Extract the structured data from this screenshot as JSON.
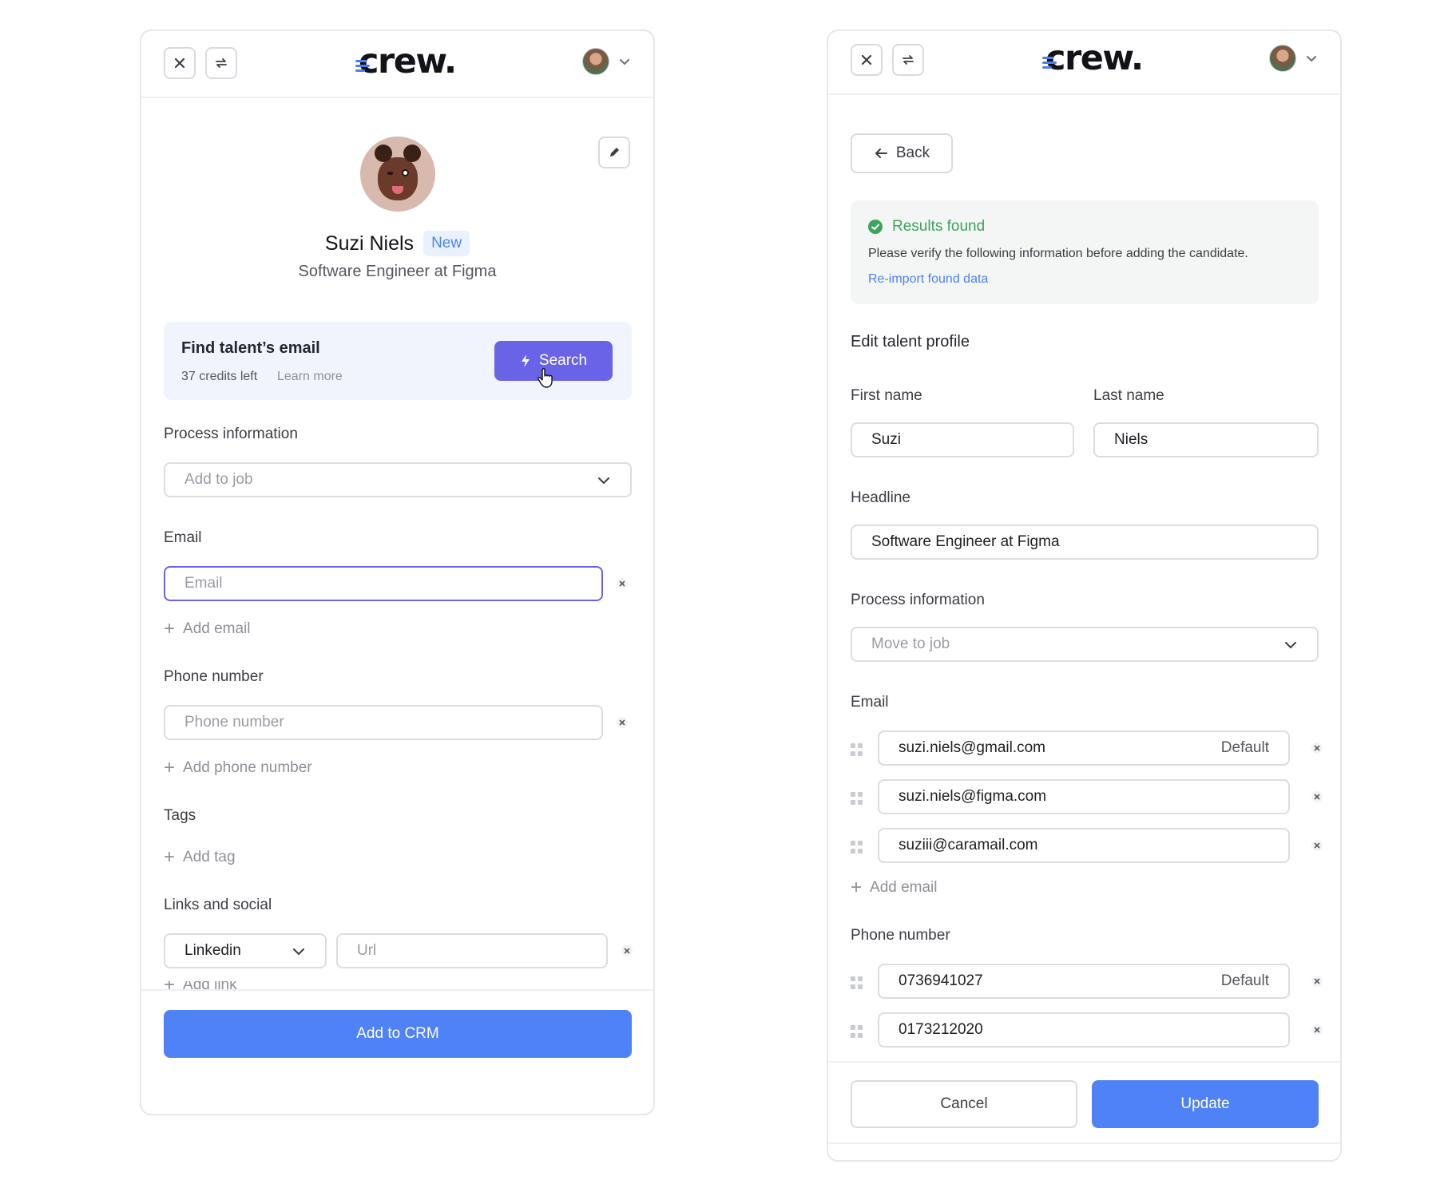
{
  "brand": {
    "logo_text": "crew.",
    "accent": "#4f82f7",
    "search_accent": "#6a63e8"
  },
  "left": {
    "topbar": {
      "close_icon": "close-icon",
      "sync_icon": "sync-icon",
      "account_icon": "chevron-down-icon"
    },
    "profile": {
      "name": "Suzi Niels",
      "badge": "New",
      "headline": "Software Engineer at Figma",
      "edit_icon": "pencil-icon"
    },
    "finder": {
      "title": "Find talent’s email",
      "credits": "37 credits left",
      "learn_more": "Learn more",
      "search_label": "Search"
    },
    "process": {
      "label": "Process information",
      "placeholder": "Add to job"
    },
    "email": {
      "label": "Email",
      "placeholder": "Email",
      "add_label": "Add email"
    },
    "phone": {
      "label": "Phone number",
      "placeholder": "Phone number",
      "add_label": "Add phone number"
    },
    "tags": {
      "label": "Tags",
      "add_label": "Add tag"
    },
    "links": {
      "label": "Links and social",
      "network": "Linkedin",
      "url_placeholder": "Url",
      "add_label": "Add link"
    },
    "cta": "Add to CRM"
  },
  "right": {
    "back_label": "Back",
    "notice": {
      "title": "Results found",
      "body": "Please verify the following information before adding the candidate.",
      "link": "Re-import found data",
      "color": "#3ea35f"
    },
    "section_title": "Edit talent profile",
    "first_name": {
      "label": "First name",
      "value": "Suzi"
    },
    "last_name": {
      "label": "Last name",
      "value": "Niels"
    },
    "headline": {
      "label": "Headline",
      "value": "Software Engineer at Figma"
    },
    "process": {
      "label": "Process information",
      "placeholder": "Move to job"
    },
    "email": {
      "label": "Email",
      "items": [
        {
          "value": "suzi.niels@gmail.com",
          "tag": "Default"
        },
        {
          "value": "suzi.niels@figma.com",
          "tag": ""
        },
        {
          "value": "suziii@caramail.com",
          "tag": ""
        }
      ],
      "add_label": "Add email"
    },
    "phone": {
      "label": "Phone number",
      "items": [
        {
          "value": "0736941027",
          "tag": "Default"
        },
        {
          "value": "0173212020",
          "tag": ""
        }
      ]
    },
    "cancel_label": "Cancel",
    "update_label": "Update"
  }
}
